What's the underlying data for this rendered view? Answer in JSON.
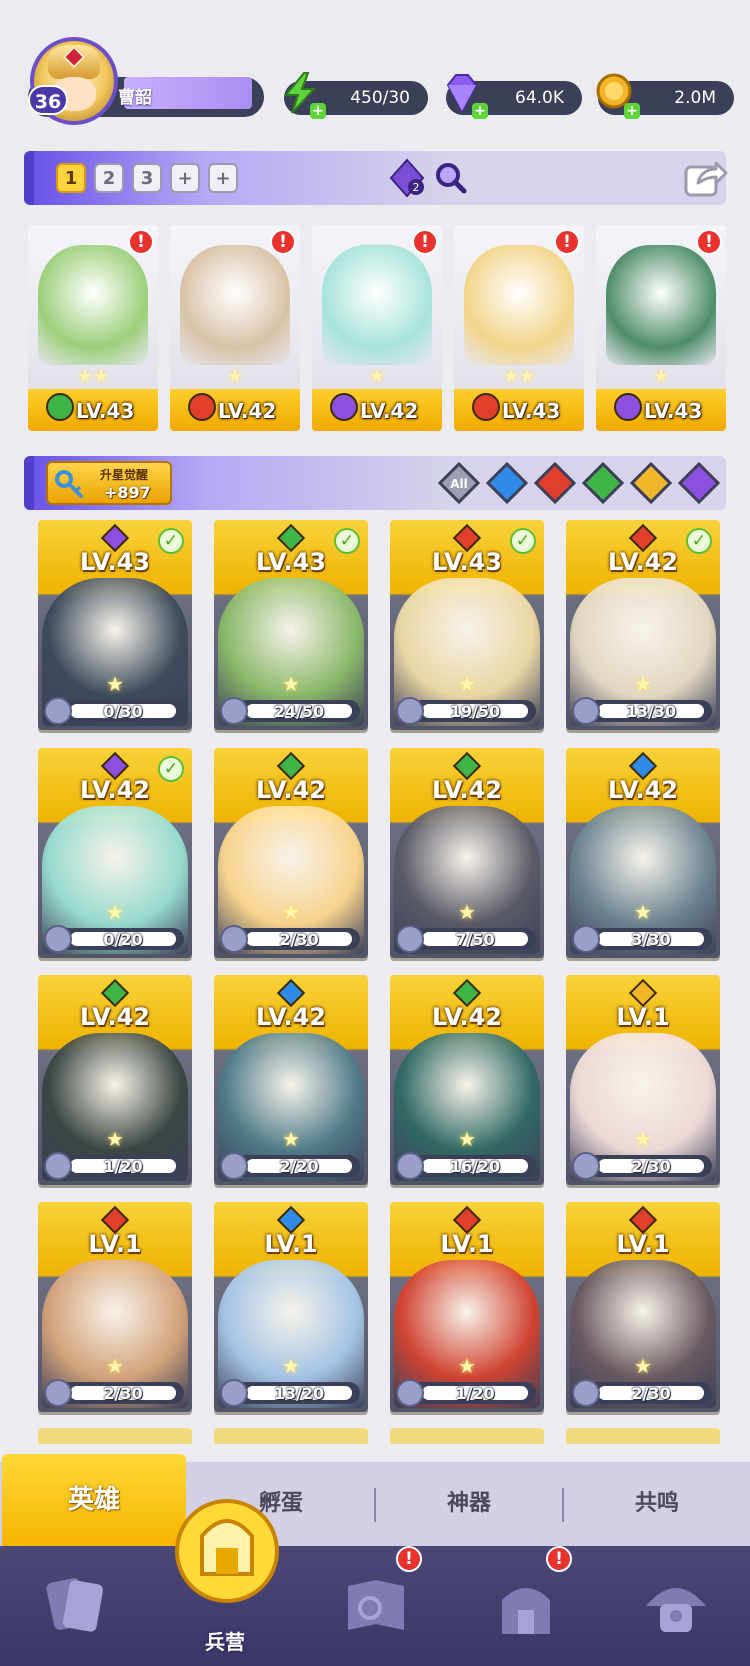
{
  "player": {
    "level": "36",
    "name": "曹韶"
  },
  "resources": [
    {
      "name": "energy",
      "icon": "lightning-icon",
      "value": "450/30",
      "color": "#5fd43a"
    },
    {
      "name": "gems",
      "icon": "diamond-icon",
      "value": "64.0K",
      "color": "#8a5cf0"
    },
    {
      "name": "gold",
      "icon": "coin-icon",
      "value": "2.0M",
      "color": "#f2b62a"
    }
  ],
  "team_bar": {
    "slots": [
      "1",
      "2",
      "3",
      "+",
      "+"
    ],
    "active_slot": 0,
    "badge": "2"
  },
  "team_heroes": [
    {
      "level": "LV.43",
      "stars": "★★",
      "element": "nature",
      "element_color": "#3fb548",
      "art_color": "#9ccf7a"
    },
    {
      "level": "LV.42",
      "stars": "★",
      "element": "fire",
      "element_color": "#e0402b",
      "art_color": "#d8c2a6"
    },
    {
      "level": "LV.42",
      "stars": "★",
      "element": "dark",
      "element_color": "#8c4fe0",
      "art_color": "#a7e3d9"
    },
    {
      "level": "LV.43",
      "stars": "★★",
      "element": "fire",
      "element_color": "#e0402b",
      "art_color": "#f2d48a"
    },
    {
      "level": "LV.43",
      "stars": "★",
      "element": "dark",
      "element_color": "#8c4fe0",
      "art_color": "#4e8d6a"
    }
  ],
  "awaken": {
    "label": "升星觉醒",
    "count": "+897"
  },
  "filters": [
    {
      "name": "all",
      "label": "All",
      "color": "#9c9fb4"
    },
    {
      "name": "water",
      "color": "#2f8be6"
    },
    {
      "name": "fire",
      "color": "#e0402b"
    },
    {
      "name": "nature",
      "color": "#3fb548"
    },
    {
      "name": "light",
      "color": "#f2b62a"
    },
    {
      "name": "dark",
      "color": "#8c4fe0"
    }
  ],
  "heroes": [
    {
      "level": "LV.43",
      "element_color": "#8c4fe0",
      "checked": true,
      "progress": "0/30",
      "fill": 0.0,
      "art": "#3c4a5a"
    },
    {
      "level": "LV.43",
      "element_color": "#3fb548",
      "checked": true,
      "progress": "24/50",
      "fill": 0.48,
      "art": "#8cbc69"
    },
    {
      "level": "LV.43",
      "element_color": "#e0402b",
      "checked": true,
      "progress": "19/50",
      "fill": 0.38,
      "art": "#f0dca6"
    },
    {
      "level": "LV.42",
      "element_color": "#e0402b",
      "checked": true,
      "progress": "13/30",
      "fill": 0.43,
      "art": "#e8dcc4"
    },
    {
      "level": "LV.42",
      "element_color": "#8c4fe0",
      "checked": true,
      "progress": "0/20",
      "fill": 0.0,
      "art": "#9ae0d2"
    },
    {
      "level": "LV.42",
      "element_color": "#3fb548",
      "checked": false,
      "progress": "2/30",
      "fill": 0.07,
      "art": "#ffd98e"
    },
    {
      "level": "LV.42",
      "element_color": "#3fb548",
      "checked": false,
      "progress": "7/50",
      "fill": 0.14,
      "art": "#5a5a66"
    },
    {
      "level": "LV.42",
      "element_color": "#2f8be6",
      "checked": false,
      "progress": "3/30",
      "fill": 0.1,
      "art": "#6d8592"
    },
    {
      "level": "LV.42",
      "element_color": "#3fb548",
      "checked": false,
      "progress": "1/20",
      "fill": 0.05,
      "art": "#3a4540"
    },
    {
      "level": "LV.42",
      "element_color": "#2f8be6",
      "checked": false,
      "progress": "2/20",
      "fill": 0.1,
      "art": "#4f7c8a"
    },
    {
      "level": "LV.42",
      "element_color": "#3fb548",
      "checked": false,
      "progress": "16/20",
      "fill": 0.8,
      "art": "#2f6a64"
    },
    {
      "level": "LV.1",
      "element_color": "#f2b62a",
      "checked": false,
      "progress": "2/30",
      "fill": 0.07,
      "art": "#f2dedb"
    },
    {
      "level": "LV.1",
      "element_color": "#e0402b",
      "checked": false,
      "progress": "2/30",
      "fill": 0.07,
      "art": "#d9a57a"
    },
    {
      "level": "LV.1",
      "element_color": "#2f8be6",
      "checked": false,
      "progress": "13/20",
      "fill": 0.65,
      "art": "#a7c8ea"
    },
    {
      "level": "LV.1",
      "element_color": "#e0402b",
      "checked": false,
      "progress": "1/20",
      "fill": 0.05,
      "art": "#d6422f"
    },
    {
      "level": "LV.1",
      "element_color": "#e0402b",
      "checked": false,
      "progress": "2/30",
      "fill": 0.07,
      "art": "#6a5a60"
    }
  ],
  "tabs": [
    "英雄",
    "孵蛋",
    "神器",
    "共鸣"
  ],
  "active_tab": 0,
  "nav": [
    {
      "name": "cards",
      "icon": "cards-icon",
      "label": "",
      "alert": false
    },
    {
      "name": "barracks",
      "icon": "barracks-icon",
      "label": "兵营",
      "alert": false,
      "active": true
    },
    {
      "name": "map",
      "icon": "map-book-icon",
      "label": "",
      "alert": true
    },
    {
      "name": "castle",
      "icon": "castle-icon",
      "label": "",
      "alert": true
    },
    {
      "name": "guild",
      "icon": "mushroom-hut-icon",
      "label": "",
      "alert": false
    }
  ]
}
